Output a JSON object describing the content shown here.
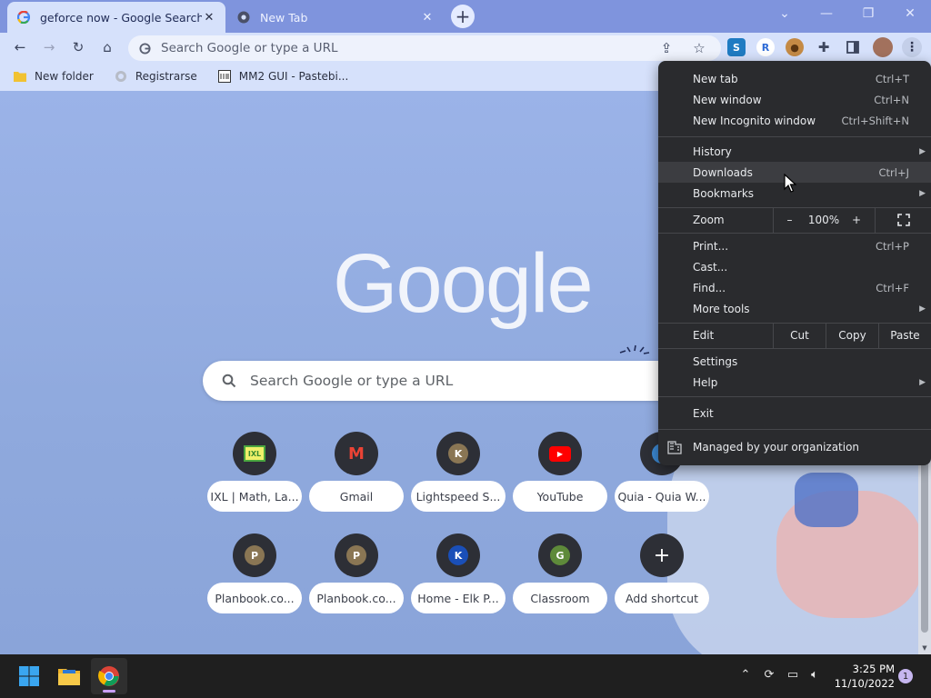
{
  "tabs": [
    {
      "title": "geforce now - Google Search",
      "favicon": "google-g-icon",
      "active": true
    },
    {
      "title": "New Tab",
      "favicon": "chrome-icon",
      "active": false
    }
  ],
  "toolbar": {
    "omnibox_placeholder": "Search Google or type a URL"
  },
  "bookmarks": [
    {
      "label": "New folder",
      "icon": "folder-icon"
    },
    {
      "label": "Registrarse",
      "icon": "globe-icon"
    },
    {
      "label": "MM2 GUI - Pastebi...",
      "icon": "pastebin-icon"
    }
  ],
  "newtab": {
    "logo_text": "Google",
    "search_placeholder": "Search Google or type a URL",
    "shortcuts": [
      {
        "label": "IXL | Math, La...",
        "icon": "IXL"
      },
      {
        "label": "Gmail",
        "icon": "M"
      },
      {
        "label": "Lightspeed S...",
        "icon": "K"
      },
      {
        "label": "YouTube",
        "icon": "▶"
      },
      {
        "label": "Quia - Quia W...",
        "icon": "Q"
      },
      {
        "label": "Planbook.co...",
        "icon": "P"
      },
      {
        "label": "Planbook.co...",
        "icon": "P"
      },
      {
        "label": "Home - Elk P...",
        "icon": "K"
      },
      {
        "label": "Classroom",
        "icon": "G"
      },
      {
        "label": "Add shortcut",
        "icon": "+"
      }
    ]
  },
  "menu": {
    "new_tab": {
      "label": "New tab",
      "shortcut": "Ctrl+T"
    },
    "new_window": {
      "label": "New window",
      "shortcut": "Ctrl+N"
    },
    "incognito": {
      "label": "New Incognito window",
      "shortcut": "Ctrl+Shift+N"
    },
    "history": {
      "label": "History"
    },
    "downloads": {
      "label": "Downloads",
      "shortcut": "Ctrl+J"
    },
    "bookmarks": {
      "label": "Bookmarks"
    },
    "zoom": {
      "label": "Zoom",
      "minus": "–",
      "value": "100%",
      "plus": "+"
    },
    "print": {
      "label": "Print...",
      "shortcut": "Ctrl+P"
    },
    "cast": {
      "label": "Cast..."
    },
    "find": {
      "label": "Find...",
      "shortcut": "Ctrl+F"
    },
    "more_tools": {
      "label": "More tools"
    },
    "edit": {
      "label": "Edit",
      "cut": "Cut",
      "copy": "Copy",
      "paste": "Paste"
    },
    "settings": {
      "label": "Settings"
    },
    "help": {
      "label": "Help"
    },
    "exit": {
      "label": "Exit"
    },
    "managed": {
      "label": "Managed by your organization"
    }
  },
  "taskbar": {
    "time": "3:25 PM",
    "date": "11/10/2022",
    "notification_count": "1"
  },
  "colors": {
    "tabstrip": "#7f94dd",
    "toolbar": "#d6e1fb",
    "menu_bg": "#2a2b2e",
    "taskbar": "#1f1f1f"
  }
}
